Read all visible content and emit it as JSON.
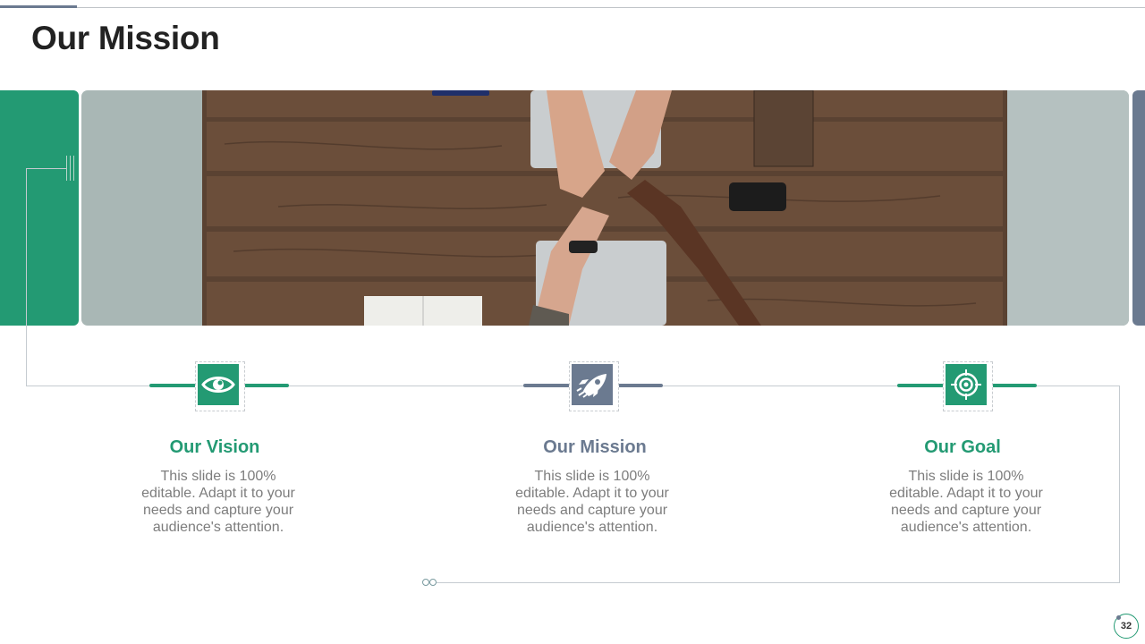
{
  "slide": {
    "title": "Our Mission",
    "page_number": "32"
  },
  "colors": {
    "green": "#239a73",
    "slate": "#6b7a90",
    "body_text": "#7d7d7d",
    "title_text": "#222222"
  },
  "photo": {
    "icon": "team-fist-bump-photo"
  },
  "columns": [
    {
      "title": "Our Vision",
      "text": "This slide is 100% editable. Adapt it to your needs and capture your audience's attention.",
      "icon": "eye-icon",
      "color": "#239a73"
    },
    {
      "title": "Our Mission",
      "text": "This slide is 100% editable. Adapt it to your needs and capture your audience's attention.",
      "icon": "rocket-icon",
      "color": "#6b7a90"
    },
    {
      "title": "Our Goal",
      "text": "This slide is 100% editable. Adapt it to your needs and capture your audience's attention.",
      "icon": "target-icon",
      "color": "#239a73"
    }
  ]
}
